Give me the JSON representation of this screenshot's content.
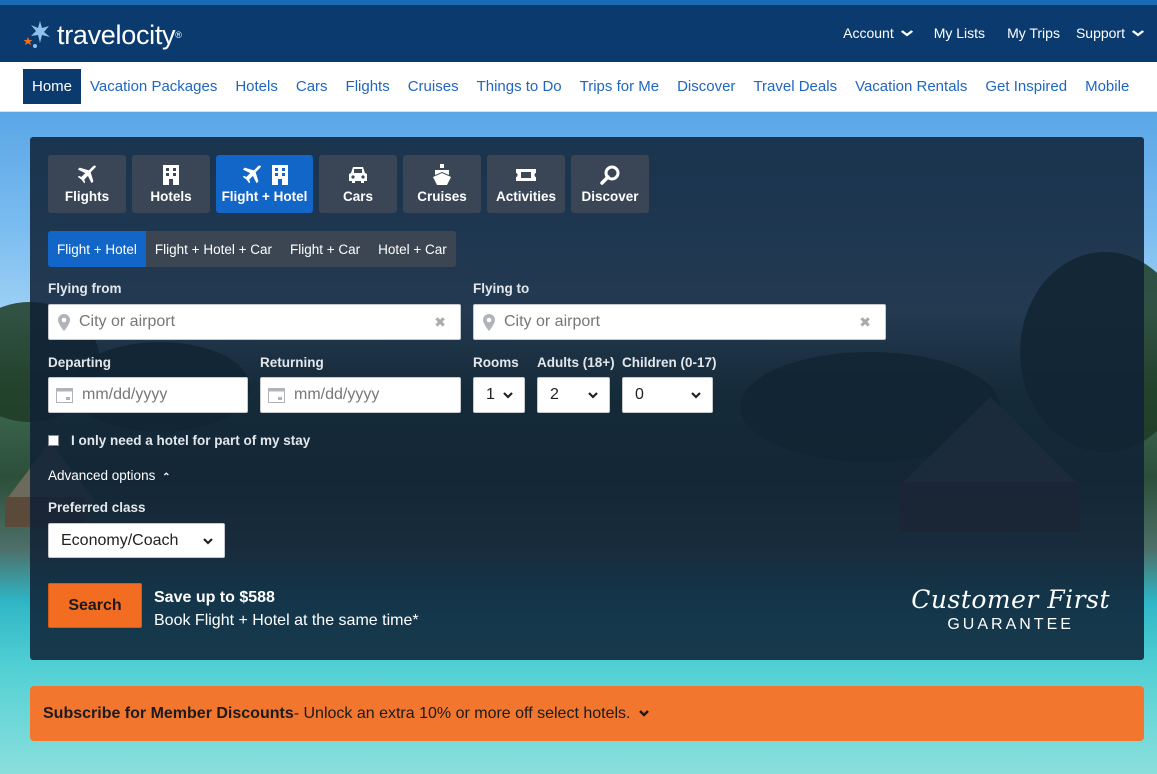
{
  "header": {
    "logo_text": "travelocity",
    "logo_tm": "®",
    "util": [
      {
        "label": "Account",
        "has_menu": true
      },
      {
        "label": "My Lists",
        "has_menu": false
      },
      {
        "label": "My Trips",
        "has_menu": false
      },
      {
        "label": "Support",
        "has_menu": true
      }
    ]
  },
  "nav": {
    "items": [
      "Home",
      "Vacation Packages",
      "Hotels",
      "Cars",
      "Flights",
      "Cruises",
      "Things to Do",
      "Trips for Me",
      "Discover",
      "Travel Deals",
      "Vacation Rentals",
      "Get Inspired",
      "Mobile"
    ],
    "active": "Home"
  },
  "search": {
    "tabs": [
      {
        "label": "Flights",
        "icon": "plane-icon"
      },
      {
        "label": "Hotels",
        "icon": "building-icon"
      },
      {
        "label": "Flight + Hotel",
        "icon": "plane-building-icon",
        "active": true
      },
      {
        "label": "Cars",
        "icon": "car-icon"
      },
      {
        "label": "Cruises",
        "icon": "ship-icon"
      },
      {
        "label": "Activities",
        "icon": "ticket-icon"
      },
      {
        "label": "Discover",
        "icon": "magnifier-icon"
      }
    ],
    "subtabs": [
      "Flight + Hotel",
      "Flight + Hotel + Car",
      "Flight + Car",
      "Hotel + Car"
    ],
    "active_subtab": "Flight + Hotel",
    "flying_from": {
      "label": "Flying from",
      "placeholder": "City or airport",
      "value": ""
    },
    "flying_to": {
      "label": "Flying to",
      "placeholder": "City or airport",
      "value": ""
    },
    "departing": {
      "label": "Departing",
      "placeholder": "mm/dd/yyyy"
    },
    "returning": {
      "label": "Returning",
      "placeholder": "mm/dd/yyyy"
    },
    "rooms": {
      "label": "Rooms",
      "value": "1"
    },
    "adults": {
      "label": "Adults (18+)",
      "value": "2"
    },
    "children": {
      "label": "Children (0-17)",
      "value": "0"
    },
    "partial_stay_label": "I only need a hotel for part of my stay",
    "partial_stay_checked": false,
    "advanced_options": "Advanced options",
    "preferred_class": {
      "label": "Preferred class",
      "value": "Economy/Coach"
    },
    "search_button": "Search",
    "promo_title": "Save up to $588",
    "promo_sub": "Book Flight + Hotel at the same time*",
    "guarantee_line1": "Customer First",
    "guarantee_line2": "GUARANTEE"
  },
  "subscribe": {
    "bold": "Subscribe for Member Discounts",
    "rest": " - Unlock an extra 10% or more off select hotels."
  },
  "colors": {
    "header_bg": "#0b3a6e",
    "link_blue": "#1f66c1",
    "tab_active": "#1266c8",
    "orange": "#f26d21"
  }
}
